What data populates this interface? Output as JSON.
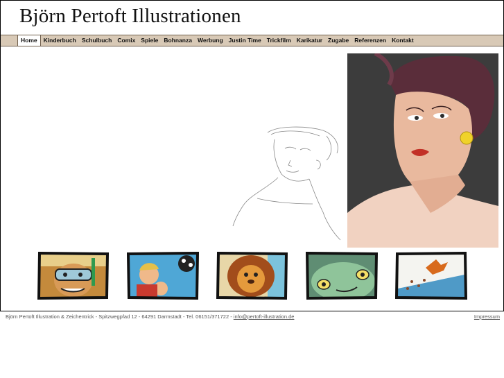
{
  "site": {
    "title": "Björn Pertoft Illustrationen"
  },
  "nav": {
    "items": [
      {
        "label": "Home",
        "active": true
      },
      {
        "label": "Kinderbuch"
      },
      {
        "label": "Schulbuch"
      },
      {
        "label": "Comix"
      },
      {
        "label": "Spiele"
      },
      {
        "label": "Bohnanza"
      },
      {
        "label": "Werbung"
      },
      {
        "label": "Justin Time"
      },
      {
        "label": "Trickfilm"
      },
      {
        "label": "Karikatur"
      },
      {
        "label": "Zugabe"
      },
      {
        "label": "Referenzen"
      },
      {
        "label": "Kontakt"
      }
    ]
  },
  "thumbnails": [
    {
      "icon": "diver-character-icon"
    },
    {
      "icon": "soccer-kids-icon"
    },
    {
      "icon": "lion-icon"
    },
    {
      "icon": "frog-icon"
    },
    {
      "icon": "fox-in-snow-icon"
    }
  ],
  "footer": {
    "text": "Björn Pertoft Illustration & Zeichentrick - Spitzwegpfad 12 - 64291 Darmstadt - Tel. 06151/371722 - ",
    "email": "info@pertoft-illustration.de",
    "impressum": "Impressum"
  },
  "colors": {
    "navbar": "#d8c9b6",
    "navbar_border": "#6e5d4b",
    "hero_dark": "#3d3d3d"
  }
}
